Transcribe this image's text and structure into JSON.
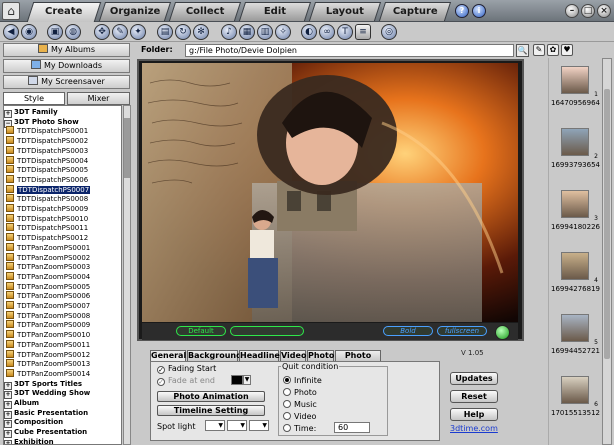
{
  "tabs": [
    {
      "label": "Create",
      "active": true
    },
    {
      "label": "Organize",
      "active": false
    },
    {
      "label": "Collect",
      "active": false
    },
    {
      "label": "Edit",
      "active": false
    },
    {
      "label": "Layout",
      "active": false
    },
    {
      "label": "Capture",
      "active": false
    }
  ],
  "window": {
    "help": "?",
    "info": "i",
    "minimize": "–",
    "maximize": "□",
    "close": "×"
  },
  "nav": {
    "albums": "My Albums",
    "downloads": "My Downloads",
    "screensaver": "My Screensaver"
  },
  "side_tabs": {
    "style": "Style",
    "mixer": "Mixer"
  },
  "tree": [
    {
      "label": "3DT Family",
      "group": true,
      "expanded": false
    },
    {
      "label": "3DT Photo Show",
      "group": true,
      "expanded": true
    },
    {
      "label": "TDTDispatchPS0001"
    },
    {
      "label": "TDTDispatchPS0002"
    },
    {
      "label": "TDTDispatchPS0003"
    },
    {
      "label": "TDTDispatchPS0004"
    },
    {
      "label": "TDTDispatchPS0005"
    },
    {
      "label": "TDTDispatchPS0006"
    },
    {
      "label": "TDTDispatchPS0007",
      "selected": true
    },
    {
      "label": "TDTDispatchPS0008"
    },
    {
      "label": "TDTDispatchPS0009"
    },
    {
      "label": "TDTDispatchPS0010"
    },
    {
      "label": "TDTDispatchPS0011"
    },
    {
      "label": "TDTDispatchPS0012"
    },
    {
      "label": "TDTPanZoomPS0001"
    },
    {
      "label": "TDTPanZoomPS0002"
    },
    {
      "label": "TDTPanZoomPS0003"
    },
    {
      "label": "TDTPanZoomPS0004"
    },
    {
      "label": "TDTPanZoomPS0005"
    },
    {
      "label": "TDTPanZoomPS0006"
    },
    {
      "label": "TDTPanZoomPS0007"
    },
    {
      "label": "TDTPanZoomPS0008"
    },
    {
      "label": "TDTPanZoomPS0009"
    },
    {
      "label": "TDTPanZoomPS0010"
    },
    {
      "label": "TDTPanZoomPS0011"
    },
    {
      "label": "TDTPanZoomPS0012"
    },
    {
      "label": "TDTPanZoomPS0013"
    },
    {
      "label": "TDTPanZoomPS0014"
    },
    {
      "label": "3DT Sports Titles",
      "group": true,
      "expanded": false
    },
    {
      "label": "3DT Wedding Show",
      "group": true,
      "expanded": false
    },
    {
      "label": "Album",
      "group": true
    },
    {
      "label": "Basic Presentation",
      "group": true
    },
    {
      "label": "Composition",
      "group": true
    },
    {
      "label": "Cube Presentation",
      "group": true
    },
    {
      "label": "Exhibition",
      "group": true
    }
  ],
  "folder": {
    "label": "Folder:",
    "path": "g:/File Photo/Devie Dolpien"
  },
  "player": {
    "default_label": "Default",
    "bold_label": "Bold",
    "fullscreen_label": "fullscreen"
  },
  "version": "V 1.05",
  "panel_tabs": [
    "General",
    "Background",
    "Headline",
    "Video",
    "Photo",
    "Photo Title"
  ],
  "general": {
    "fading_start": "Fading Start",
    "fade_at_end": "Fade at end",
    "photo_animation": "Photo Animation",
    "timeline_setting": "Timeline Setting",
    "spot_light": "Spot light",
    "quit_condition": "Quit condition",
    "quit_options": [
      "Infinite",
      "Photo",
      "Music",
      "Video",
      "Time:"
    ],
    "time_value": "60"
  },
  "actions": {
    "updates": "Updates",
    "reset": "Reset",
    "help": "Help",
    "site": "3dtime.com"
  },
  "thumbnails": [
    {
      "num": "1",
      "id": "16470956964"
    },
    {
      "num": "2",
      "id": "16993793654"
    },
    {
      "num": "3",
      "id": "16994180226"
    },
    {
      "num": "4",
      "id": "16994276819"
    },
    {
      "num": "5",
      "id": "16994452721"
    },
    {
      "num": "6",
      "id": "17015513512"
    }
  ]
}
